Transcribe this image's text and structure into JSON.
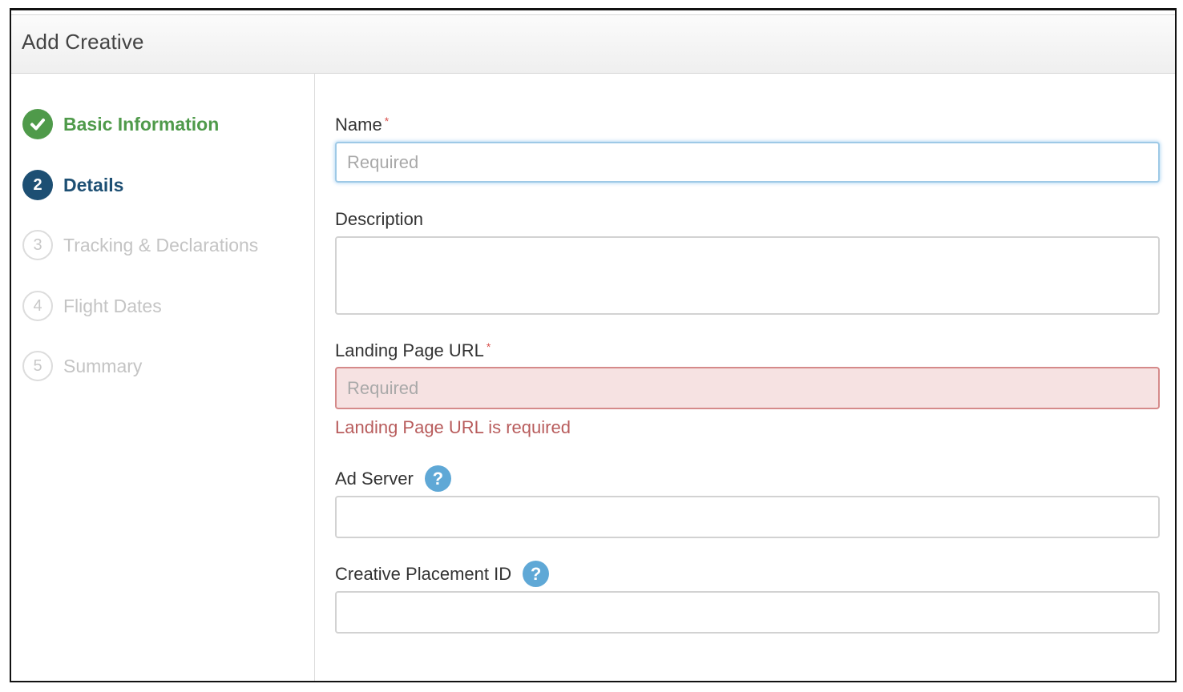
{
  "dialog": {
    "title": "Add Creative"
  },
  "steps": [
    {
      "number": "",
      "label": "Basic Information",
      "state": "done"
    },
    {
      "number": "2",
      "label": "Details",
      "state": "current"
    },
    {
      "number": "3",
      "label": "Tracking & Declarations",
      "state": "todo"
    },
    {
      "number": "4",
      "label": "Flight Dates",
      "state": "todo"
    },
    {
      "number": "5",
      "label": "Summary",
      "state": "todo"
    }
  ],
  "form": {
    "name": {
      "label": "Name",
      "required_mark": "*",
      "placeholder": "Required",
      "value": ""
    },
    "description": {
      "label": "Description",
      "value": ""
    },
    "landing_page_url": {
      "label": "Landing Page URL",
      "required_mark": "*",
      "placeholder": "Required",
      "value": "",
      "error": "Landing Page URL is required"
    },
    "ad_server": {
      "label": "Ad Server",
      "help_icon": "?",
      "value": ""
    },
    "creative_placement_id": {
      "label": "Creative Placement ID",
      "help_icon": "?",
      "value": ""
    }
  },
  "colors": {
    "done": "#4f9a4a",
    "current": "#1d4f73",
    "todo": "#c4c4c4",
    "error_text": "#b85c5c",
    "error_bg": "#f6e2e2",
    "help_icon": "#5fa8d6"
  }
}
